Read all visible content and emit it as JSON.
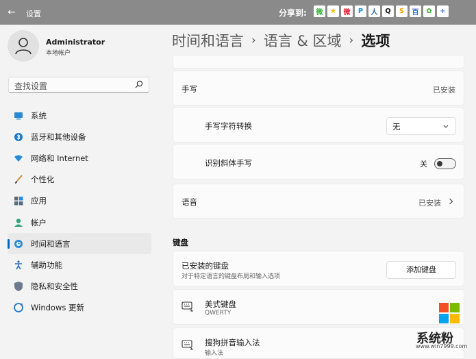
{
  "window": {
    "title": "设置",
    "back": "←"
  },
  "share": {
    "label": "分享到:",
    "icons": [
      {
        "name": "wechat-icon",
        "glyph": "微",
        "color": "#33b03b"
      },
      {
        "name": "qzone-icon",
        "glyph": "★",
        "color": "#f5b800"
      },
      {
        "name": "weibo-icon",
        "glyph": "微",
        "color": "#e6162d"
      },
      {
        "name": "tencent-weibo-icon",
        "glyph": "P",
        "color": "#1f8fd4"
      },
      {
        "name": "renren-icon",
        "glyph": "人",
        "color": "#1a5ea8"
      },
      {
        "name": "qq-icon",
        "glyph": "Q",
        "color": "#111111"
      },
      {
        "name": "sohu-icon",
        "glyph": "S",
        "color": "#f6a400"
      },
      {
        "name": "baidu-icon",
        "glyph": "百",
        "color": "#2b6fd6"
      },
      {
        "name": "kaixin-icon",
        "glyph": "✿",
        "color": "#2fa52f"
      },
      {
        "name": "more-share-icon",
        "glyph": "+",
        "color": "#2c84d8"
      }
    ]
  },
  "profile": {
    "name": "Administrator",
    "subtitle": "本地帐户"
  },
  "search": {
    "placeholder": "查找设置"
  },
  "nav": {
    "items": [
      {
        "label": "系统",
        "icon": "system-icon"
      },
      {
        "label": "蓝牙和其他设备",
        "icon": "bluetooth-icon"
      },
      {
        "label": "网络和 Internet",
        "icon": "network-icon"
      },
      {
        "label": "个性化",
        "icon": "brush-icon"
      },
      {
        "label": "应用",
        "icon": "apps-icon"
      },
      {
        "label": "帐户",
        "icon": "account-icon"
      },
      {
        "label": "时间和语言",
        "icon": "time-language-icon",
        "active": true
      },
      {
        "label": "辅助功能",
        "icon": "accessibility-icon"
      },
      {
        "label": "隐私和安全性",
        "icon": "shield-icon"
      },
      {
        "label": "Windows 更新",
        "icon": "update-icon"
      }
    ]
  },
  "breadcrumb": {
    "part1": "时间和语言",
    "part2": "语言 & 区域",
    "current": "选项",
    "sep": "›"
  },
  "handwriting": {
    "label": "手写",
    "status": "已安装",
    "conversion_label": "手写字符转换",
    "conversion_value": "无",
    "italic_label": "识别斜体手写",
    "italic_state": "关"
  },
  "speech": {
    "label": "语音",
    "status": "已安装"
  },
  "keyboard": {
    "section_title": "键盘",
    "installed_label": "已安装的键盘",
    "installed_desc": "对于特定语言的键盘布局和输入选项",
    "add_button": "添加键盘",
    "keyboards": [
      {
        "name": "美式键盘",
        "sub": "QWERTY"
      },
      {
        "name": "搜狗拼音输入法",
        "sub": "输入法"
      }
    ]
  },
  "watermark": {
    "text": "系统粉",
    "url": "www.win7999.com"
  },
  "colors": {
    "accent": "#0067c0",
    "titlebar": "#8a8a8a",
    "background": "#f3f3f3"
  }
}
